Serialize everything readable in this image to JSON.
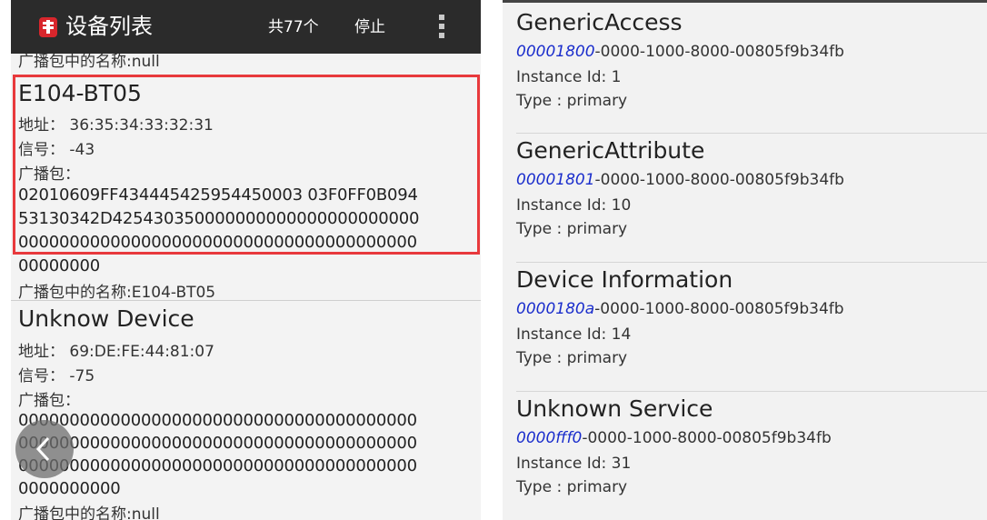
{
  "device_list_screen": {
    "title": "设备列表",
    "count_label": "共77个",
    "stop_label": "停止",
    "clipped_top_text": "广播包中的名称:null",
    "devices": [
      {
        "name": "E104-BT05",
        "address": "地址： 36:35:34:33:32:31",
        "rssi": "信号： -43",
        "adv_label": "广播包：",
        "adv_lines": [
          "02010609FF434445425954450003 03F0FF0B094",
          "53130342D425430350000000000000000000000",
          "000000000000000000000000000000000000000",
          "00000000"
        ],
        "adv_name": "广播包中的名称:E104-BT05"
      },
      {
        "name": "Unknow Device",
        "address": "地址： 69:DE:FE:44:81:07",
        "rssi": "信号： -75",
        "adv_label": "广播包：",
        "adv_lines": [
          "000000000000000000000000000000000000000",
          "000000000000000000000000000000000000000",
          "000000000000000000000000000000000000000",
          "0000000000"
        ],
        "adv_name": "广播包中的名称:null"
      }
    ],
    "colors": {
      "actionbar": "#2b2b2b",
      "selection": "#e8393c"
    },
    "icons": {
      "app": "app-logo-icon",
      "menu": "overflow-menu-icon",
      "back": "back-chevron-icon"
    }
  },
  "service_list_screen": {
    "services": [
      {
        "name": "GenericAccess",
        "uuid_prefix": "00001800",
        "uuid_rest": "-0000-1000-8000-00805f9b34fb",
        "instance": "Instance Id: 1",
        "type": "Type : primary"
      },
      {
        "name": "GenericAttribute",
        "uuid_prefix": "00001801",
        "uuid_rest": "-0000-1000-8000-00805f9b34fb",
        "instance": "Instance Id: 10",
        "type": "Type : primary"
      },
      {
        "name": "Device Information",
        "uuid_prefix": "0000180a",
        "uuid_rest": "-0000-1000-8000-00805f9b34fb",
        "instance": "Instance Id: 14",
        "type": "Type : primary"
      },
      {
        "name": "Unknown Service",
        "uuid_prefix": "0000fff0",
        "uuid_rest": "-0000-1000-8000-00805f9b34fb",
        "instance": "Instance Id: 31",
        "type": "Type : primary"
      }
    ],
    "colors": {
      "uuid_prefix": "#1a2dcc"
    }
  }
}
